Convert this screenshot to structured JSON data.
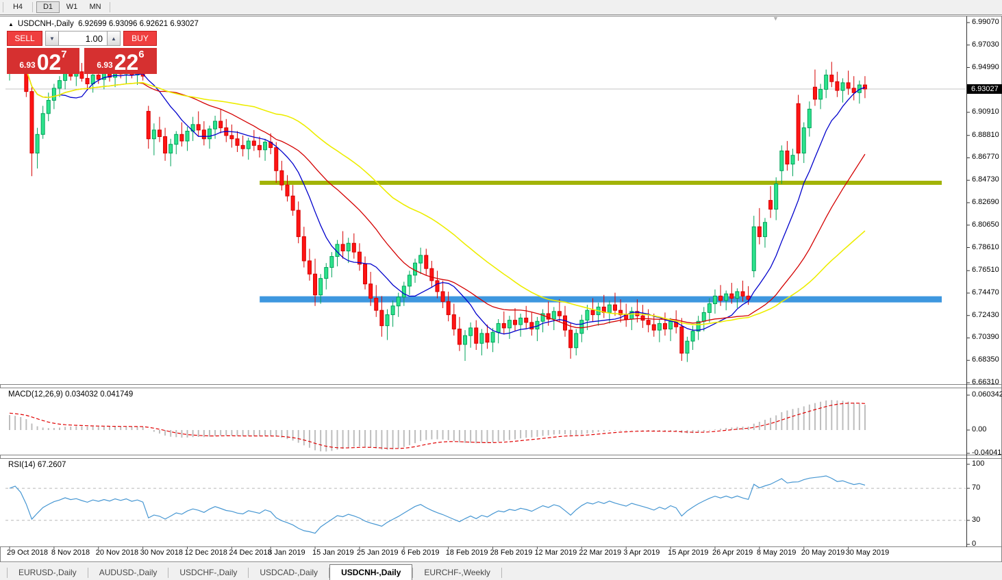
{
  "toolbar": {
    "timeframes": [
      "H4",
      "D1",
      "W1",
      "MN"
    ],
    "active": "D1"
  },
  "window": {
    "title": {
      "collapse_icon": "▲",
      "symbol": "USDCNH-,Daily",
      "ohlc": "6.92699 6.93096 6.92621 6.93027"
    },
    "scroll_marker_icon": "▼",
    "trade_panel": {
      "sell_label": "SELL",
      "buy_label": "BUY",
      "volume": "1.00",
      "spin_down_icon": "▼",
      "spin_up_icon": "▲",
      "sell_quote": {
        "small": "6.93",
        "big": "02",
        "sup": "7"
      },
      "buy_quote": {
        "small": "6.93",
        "big": "22",
        "sup": "6"
      }
    },
    "price_axis": {
      "labels": [
        "6.99070",
        "6.97030",
        "6.94990",
        "6.90910",
        "6.88810",
        "6.86770",
        "6.84730",
        "6.82690",
        "6.80650",
        "6.78610",
        "6.76510",
        "6.74470",
        "6.72430",
        "6.70390",
        "6.68350",
        "6.66310"
      ],
      "current": "6.93027"
    },
    "macd_label": "MACD(12,26,9) 0.034032 0.041749",
    "macd_axis": [
      "0.060342",
      "0.00",
      "-0.04041"
    ],
    "rsi_label": "RSI(14) 67.2607",
    "rsi_axis": [
      "100",
      "70",
      "30",
      "0"
    ],
    "date_axis": [
      "29 Oct 2018",
      "8 Nov 2018",
      "20 Nov 2018",
      "30 Nov 2018",
      "12 Dec 2018",
      "24 Dec 2018",
      "3 Jan 2019",
      "15 Jan 2019",
      "25 Jan 2019",
      "6 Feb 2019",
      "18 Feb 2019",
      "28 Feb 2019",
      "12 Mar 2019",
      "22 Mar 2019",
      "3 Apr 2019",
      "15 Apr 2019",
      "26 Apr 2019",
      "8 May 2019",
      "20 May 2019",
      "30 May 2019"
    ]
  },
  "tabs": {
    "items": [
      "EURUSD-,Daily",
      "AUDUSD-,Daily",
      "USDCHF-,Daily",
      "USDCAD-,Daily",
      "USDCNH-,Daily",
      "EURCHF-,Weekly"
    ],
    "active": "USDCNH-,Daily"
  },
  "chart_data": {
    "type": "candlestick",
    "symbol": "USDCNH-",
    "timeframe": "Daily",
    "current_ohlc": {
      "open": 6.92699,
      "high": 6.93096,
      "low": 6.92621,
      "close": 6.93027
    },
    "y_axis_ticks": [
      6.9907,
      6.9703,
      6.9499,
      6.9091,
      6.8881,
      6.8677,
      6.8473,
      6.8269,
      6.8065,
      6.7861,
      6.7651,
      6.7447,
      6.7243,
      6.7039,
      6.6835,
      6.6631
    ],
    "current_price": 6.93027,
    "x_labels": [
      "29 Oct 2018",
      "8 Nov 2018",
      "20 Nov 2018",
      "30 Nov 2018",
      "12 Dec 2018",
      "24 Dec 2018",
      "3 Jan 2019",
      "15 Jan 2019",
      "25 Jan 2019",
      "6 Feb 2019",
      "18 Feb 2019",
      "28 Feb 2019",
      "12 Mar 2019",
      "22 Mar 2019",
      "3 Apr 2019",
      "15 Apr 2019",
      "26 Apr 2019",
      "8 May 2019",
      "20 May 2019",
      "30 May 2019"
    ],
    "x_label_bars": [
      0,
      8,
      16,
      24,
      32,
      40,
      47,
      55,
      63,
      71,
      79,
      87,
      95,
      103,
      111,
      119,
      127,
      135,
      143,
      151
    ],
    "horizontal_lines": [
      {
        "price": 6.845,
        "color": "#a2b307",
        "thickness": 6,
        "from_bar": 47,
        "to_bar": 155
      },
      {
        "price": 6.739,
        "color": "#3e97df",
        "thickness": 9,
        "from_bar": 47,
        "to_bar": 155
      }
    ],
    "moving_averages": [
      {
        "period": 10,
        "color": "#0000cc"
      },
      {
        "period": 24,
        "color": "#d40000"
      },
      {
        "period": 45,
        "color": "#eded00"
      }
    ],
    "indicators": {
      "macd": {
        "params": "12,26,9",
        "main": 0.034032,
        "signal": 0.041749,
        "axis_max": 0.060342,
        "axis_min": -0.04041,
        "hist_color": "#bdbdbd",
        "signal_color": "#e00000"
      },
      "rsi": {
        "period": 14,
        "value": 67.2607,
        "levels": [
          70,
          30
        ],
        "axis": [
          100,
          70,
          30,
          0
        ],
        "line_color": "#4596d2"
      }
    },
    "colors": {
      "bull_fill": "#2de28c",
      "bull_border": "#00a35a",
      "bear_fill": "#ff1414",
      "bear_border": "#d60000",
      "grid_gray": "#c4c4c4",
      "tag_bg": "#000000"
    },
    "candles": [
      [
        6.945,
        6.956,
        6.938,
        6.953
      ],
      [
        6.953,
        6.964,
        6.945,
        6.96
      ],
      [
        6.96,
        6.966,
        6.948,
        6.951
      ],
      [
        6.951,
        6.956,
        6.923,
        6.928
      ],
      [
        6.928,
        6.932,
        6.851,
        6.872
      ],
      [
        6.872,
        6.895,
        6.858,
        6.889
      ],
      [
        6.889,
        6.915,
        6.885,
        6.908
      ],
      [
        6.908,
        6.927,
        6.901,
        6.92
      ],
      [
        6.92,
        6.935,
        6.912,
        6.931
      ],
      [
        6.931,
        6.942,
        6.923,
        6.938
      ],
      [
        6.938,
        6.952,
        6.93,
        6.948
      ],
      [
        6.948,
        6.956,
        6.938,
        6.942
      ],
      [
        6.942,
        6.95,
        6.933,
        6.946
      ],
      [
        6.946,
        6.954,
        6.937,
        6.94
      ],
      [
        6.94,
        6.948,
        6.929,
        6.935
      ],
      [
        6.935,
        6.946,
        6.927,
        6.943
      ],
      [
        6.943,
        6.953,
        6.935,
        6.939
      ],
      [
        6.939,
        6.948,
        6.93,
        6.945
      ],
      [
        6.945,
        6.955,
        6.937,
        6.941
      ],
      [
        6.941,
        6.95,
        6.932,
        6.948
      ],
      [
        6.948,
        6.957,
        6.94,
        6.944
      ],
      [
        6.944,
        6.952,
        6.935,
        6.949
      ],
      [
        6.949,
        6.956,
        6.94,
        6.943
      ],
      [
        6.943,
        6.951,
        6.934,
        6.947
      ],
      [
        6.947,
        6.954,
        6.938,
        6.942
      ],
      [
        6.91,
        6.915,
        6.876,
        6.885
      ],
      [
        6.885,
        6.899,
        6.87,
        6.893
      ],
      [
        6.893,
        6.905,
        6.882,
        6.887
      ],
      [
        6.887,
        6.895,
        6.865,
        6.872
      ],
      [
        6.872,
        6.885,
        6.86,
        6.88
      ],
      [
        6.88,
        6.892,
        6.871,
        6.889
      ],
      [
        6.889,
        6.9,
        6.878,
        6.883
      ],
      [
        6.883,
        6.896,
        6.874,
        6.892
      ],
      [
        6.892,
        6.905,
        6.883,
        6.898
      ],
      [
        6.898,
        6.91,
        6.887,
        6.893
      ],
      [
        6.893,
        6.901,
        6.879,
        6.885
      ],
      [
        6.885,
        6.897,
        6.876,
        6.894
      ],
      [
        6.894,
        6.906,
        6.885,
        6.901
      ],
      [
        6.901,
        6.912,
        6.89,
        6.895
      ],
      [
        6.895,
        6.903,
        6.882,
        6.888
      ],
      [
        6.888,
        6.898,
        6.877,
        6.885
      ],
      [
        6.885,
        6.892,
        6.873,
        6.879
      ],
      [
        6.879,
        6.888,
        6.869,
        6.876
      ],
      [
        6.876,
        6.886,
        6.866,
        6.883
      ],
      [
        6.883,
        6.893,
        6.874,
        6.879
      ],
      [
        6.879,
        6.887,
        6.868,
        6.875
      ],
      [
        6.875,
        6.885,
        6.865,
        6.882
      ],
      [
        6.882,
        6.89,
        6.871,
        6.877
      ],
      [
        6.877,
        6.882,
        6.845,
        6.856
      ],
      [
        6.856,
        6.865,
        6.838,
        6.843
      ],
      [
        6.843,
        6.852,
        6.828,
        6.833
      ],
      [
        6.833,
        6.843,
        6.815,
        6.82
      ],
      [
        6.82,
        6.828,
        6.79,
        6.796
      ],
      [
        6.796,
        6.805,
        6.768,
        6.774
      ],
      [
        6.774,
        6.785,
        6.756,
        6.762
      ],
      [
        6.762,
        6.776,
        6.733,
        6.743
      ],
      [
        6.743,
        6.762,
        6.735,
        6.758
      ],
      [
        6.758,
        6.772,
        6.748,
        6.768
      ],
      [
        6.768,
        6.782,
        6.759,
        6.778
      ],
      [
        6.778,
        6.793,
        6.769,
        6.789
      ],
      [
        6.789,
        6.801,
        6.776,
        6.783
      ],
      [
        6.783,
        6.795,
        6.772,
        6.79
      ],
      [
        6.79,
        6.799,
        6.776,
        6.782
      ],
      [
        6.782,
        6.79,
        6.765,
        6.771
      ],
      [
        6.771,
        6.778,
        6.748,
        6.753
      ],
      [
        6.753,
        6.764,
        6.733,
        6.74
      ],
      [
        6.74,
        6.752,
        6.723,
        6.729
      ],
      [
        6.729,
        6.742,
        6.705,
        6.715
      ],
      [
        6.715,
        6.73,
        6.702,
        6.725
      ],
      [
        6.725,
        6.738,
        6.714,
        6.733
      ],
      [
        6.733,
        6.745,
        6.723,
        6.741
      ],
      [
        6.741,
        6.755,
        6.733,
        6.751
      ],
      [
        6.751,
        6.765,
        6.743,
        6.761
      ],
      [
        6.761,
        6.776,
        6.754,
        6.772
      ],
      [
        6.772,
        6.786,
        6.762,
        6.779
      ],
      [
        6.779,
        6.785,
        6.761,
        6.767
      ],
      [
        6.767,
        6.774,
        6.75,
        6.756
      ],
      [
        6.756,
        6.765,
        6.74,
        6.746
      ],
      [
        6.746,
        6.756,
        6.731,
        6.737
      ],
      [
        6.737,
        6.746,
        6.719,
        6.725
      ],
      [
        6.725,
        6.735,
        6.706,
        6.712
      ],
      [
        6.712,
        6.723,
        6.692,
        6.698
      ],
      [
        6.698,
        6.711,
        6.683,
        6.706
      ],
      [
        6.706,
        6.718,
        6.695,
        6.713
      ],
      [
        6.713,
        6.72,
        6.693,
        6.699
      ],
      [
        6.699,
        6.712,
        6.688,
        6.708
      ],
      [
        6.708,
        6.716,
        6.694,
        6.7
      ],
      [
        6.7,
        6.713,
        6.691,
        6.709
      ],
      [
        6.709,
        6.721,
        6.699,
        6.717
      ],
      [
        6.717,
        6.728,
        6.707,
        6.713
      ],
      [
        6.713,
        6.724,
        6.703,
        6.72
      ],
      [
        6.72,
        6.731,
        6.71,
        6.716
      ],
      [
        6.716,
        6.726,
        6.705,
        6.722
      ],
      [
        6.722,
        6.733,
        6.712,
        6.718
      ],
      [
        6.718,
        6.727,
        6.706,
        6.712
      ],
      [
        6.712,
        6.723,
        6.701,
        6.719
      ],
      [
        6.719,
        6.73,
        6.709,
        6.726
      ],
      [
        6.726,
        6.737,
        6.715,
        6.721
      ],
      [
        6.721,
        6.732,
        6.711,
        6.728
      ],
      [
        6.728,
        6.739,
        6.718,
        6.724
      ],
      [
        6.724,
        6.733,
        6.705,
        6.711
      ],
      [
        6.711,
        6.718,
        6.685,
        6.695
      ],
      [
        6.695,
        6.712,
        6.688,
        6.708
      ],
      [
        6.708,
        6.725,
        6.7,
        6.72
      ],
      [
        6.72,
        6.734,
        6.711,
        6.729
      ],
      [
        6.729,
        6.74,
        6.719,
        6.725
      ],
      [
        6.725,
        6.736,
        6.715,
        6.732
      ],
      [
        6.732,
        6.743,
        6.722,
        6.727
      ],
      [
        6.727,
        6.738,
        6.717,
        6.734
      ],
      [
        6.734,
        6.745,
        6.724,
        6.729
      ],
      [
        6.729,
        6.739,
        6.718,
        6.725
      ],
      [
        6.725,
        6.735,
        6.714,
        6.721
      ],
      [
        6.721,
        6.732,
        6.711,
        6.728
      ],
      [
        6.728,
        6.739,
        6.718,
        6.724
      ],
      [
        6.724,
        6.734,
        6.713,
        6.72
      ],
      [
        6.72,
        6.73,
        6.709,
        6.716
      ],
      [
        6.716,
        6.726,
        6.705,
        6.711
      ],
      [
        6.711,
        6.721,
        6.7,
        6.717
      ],
      [
        6.717,
        6.727,
        6.706,
        6.712
      ],
      [
        6.712,
        6.722,
        6.701,
        6.719
      ],
      [
        6.719,
        6.729,
        6.708,
        6.714
      ],
      [
        6.714,
        6.722,
        6.683,
        6.69
      ],
      [
        6.69,
        6.705,
        6.682,
        6.701
      ],
      [
        6.701,
        6.715,
        6.693,
        6.71
      ],
      [
        6.71,
        6.724,
        6.702,
        6.719
      ],
      [
        6.719,
        6.732,
        6.71,
        6.727
      ],
      [
        6.727,
        6.74,
        6.718,
        6.735
      ],
      [
        6.735,
        6.748,
        6.726,
        6.742
      ],
      [
        6.742,
        6.752,
        6.733,
        6.738
      ],
      [
        6.738,
        6.747,
        6.729,
        6.744
      ],
      [
        6.744,
        6.754,
        6.735,
        6.74
      ],
      [
        6.74,
        6.749,
        6.731,
        6.746
      ],
      [
        6.746,
        6.756,
        6.737,
        6.742
      ],
      [
        6.742,
        6.751,
        6.734,
        6.739
      ],
      [
        6.765,
        6.815,
        6.759,
        6.805
      ],
      [
        6.805,
        6.822,
        6.789,
        6.796
      ],
      [
        6.796,
        6.813,
        6.786,
        6.809
      ],
      [
        6.829,
        6.842,
        6.813,
        6.821
      ],
      [
        6.821,
        6.85,
        6.811,
        6.844
      ],
      [
        6.856,
        6.879,
        6.844,
        6.874
      ],
      [
        6.874,
        6.883,
        6.856,
        6.862
      ],
      [
        6.862,
        6.876,
        6.851,
        6.87
      ],
      [
        6.917,
        6.925,
        6.865,
        6.872
      ],
      [
        6.872,
        6.9,
        6.863,
        6.895
      ],
      [
        6.895,
        6.919,
        6.887,
        6.912
      ],
      [
        6.932,
        6.948,
        6.915,
        6.921
      ],
      [
        6.921,
        6.935,
        6.912,
        6.93
      ],
      [
        6.93,
        6.948,
        6.922,
        6.943
      ],
      [
        6.943,
        6.955,
        6.932,
        6.937
      ],
      [
        6.937,
        6.946,
        6.923,
        6.929
      ],
      [
        6.929,
        6.94,
        6.918,
        6.936
      ],
      [
        6.936,
        6.947,
        6.925,
        6.931
      ],
      [
        6.931,
        6.942,
        6.92,
        6.927
      ],
      [
        6.927,
        6.938,
        6.917,
        6.934
      ],
      [
        6.934,
        6.942,
        6.922,
        6.9303
      ]
    ]
  }
}
